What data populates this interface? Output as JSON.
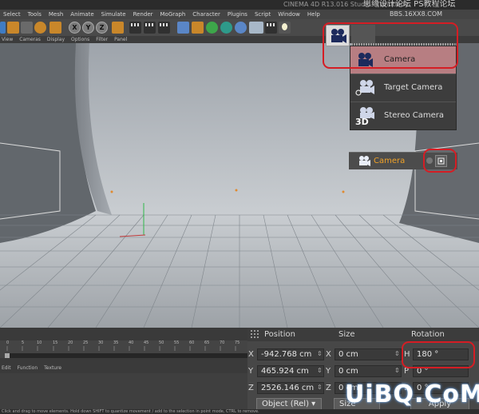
{
  "window": {
    "title": "CINEMA 4D R13.016 Studio - [Untitled]",
    "watermark_top": "思缘设计论坛  PS教程论坛",
    "watermark_url": "BBS.16XX8.COM",
    "watermark_bottom": "UiBQ.CoM"
  },
  "menubar": [
    "Select",
    "Tools",
    "Mesh",
    "Animate",
    "Simulate",
    "Render",
    "MoGraph",
    "Character",
    "Plugins",
    "Script",
    "Window",
    "Help"
  ],
  "toolbar": {
    "axis_labels": [
      "X",
      "Y",
      "Z"
    ],
    "icons": [
      "cursor-icon",
      "move-icon",
      "scale-icon",
      "rotate-icon",
      "add-icon",
      "x-axis-icon",
      "y-axis-icon",
      "z-axis-icon",
      "world-coords-icon",
      "render-region-icon",
      "render-view-icon",
      "render-settings-icon",
      "cube-icon",
      "spline-icon",
      "nurbs-icon",
      "array-icon",
      "deformer-icon",
      "floor-icon",
      "camera-icon",
      "light-icon"
    ]
  },
  "viewport_menu": [
    "View",
    "Cameras",
    "Display",
    "Options",
    "Filter",
    "Panel"
  ],
  "camera_menu": {
    "items": [
      {
        "label": "Camera",
        "icon": "camera-icon",
        "selected": true
      },
      {
        "label": "Target Camera",
        "icon": "target-camera-icon",
        "selected": false
      },
      {
        "label": "Stereo Camera",
        "icon": "stereo-camera-icon",
        "badge": "3D",
        "selected": false
      }
    ]
  },
  "object_row": {
    "label": "Camera",
    "icon": "camera-icon"
  },
  "timeline": {
    "ticks": [
      "0",
      "5",
      "10",
      "15",
      "20",
      "25",
      "30",
      "35",
      "40",
      "45",
      "50",
      "55",
      "60",
      "65",
      "70",
      "75"
    ]
  },
  "bottom_menu": [
    "Edit",
    "Function",
    "Texture"
  ],
  "attributes": {
    "headers": {
      "position": "Position",
      "size": "Size",
      "rotation": "Rotation"
    },
    "rows": [
      {
        "axis": "X",
        "position": "-942.768 cm",
        "size_axis": "X",
        "size": "0 cm",
        "rot_axis": "H",
        "rotation": "180 °"
      },
      {
        "axis": "Y",
        "position": "465.924 cm",
        "size_axis": "Y",
        "size": "0 cm",
        "rot_axis": "P",
        "rotation": "0 °"
      },
      {
        "axis": "Z",
        "position": "2526.146 cm",
        "size_axis": "Z",
        "size": "0 cm",
        "rot_axis": "B",
        "rotation": "0 °"
      }
    ],
    "coord_mode": "Object (Rel)",
    "size_mode": "Size",
    "apply_label": "Apply"
  },
  "statusbar": "Click and drag to move elements. Hold down SHIFT to quantize movement / add to the selection in point mode, CTRL to remove.",
  "colors": {
    "highlight": "#b77e82",
    "object_label": "#f1a227",
    "annotation": "#d51d24"
  }
}
